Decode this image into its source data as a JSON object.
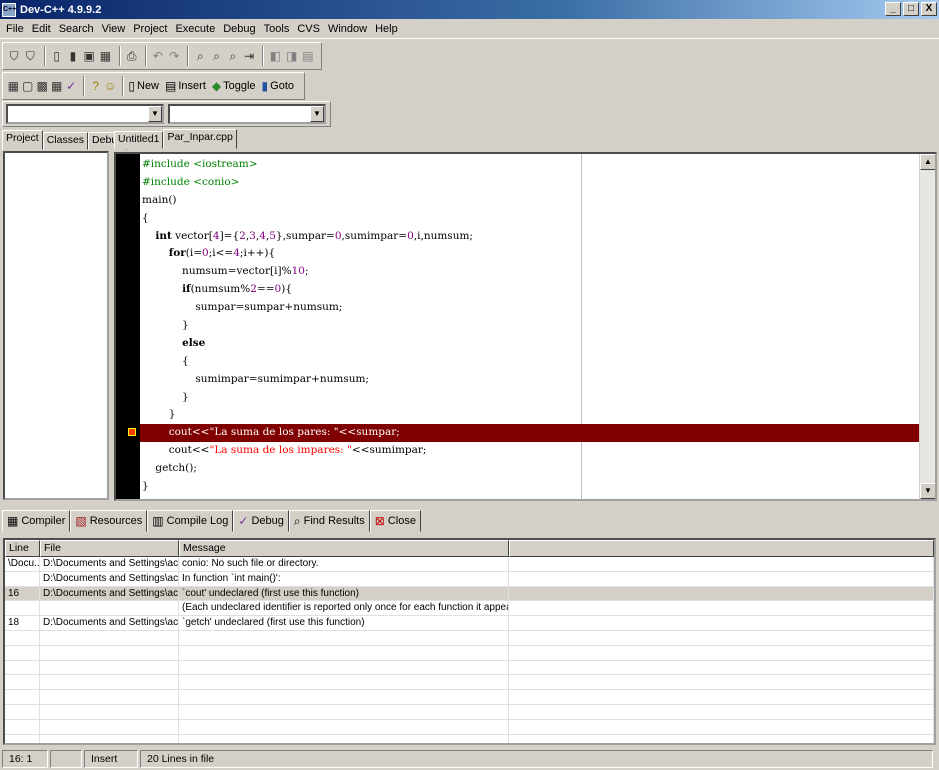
{
  "window": {
    "title": "Dev-C++ 4.9.9.2",
    "app_icon": "dev-cpp-icon",
    "controls": [
      "_",
      "□",
      "X"
    ]
  },
  "menu": [
    "File",
    "Edit",
    "Search",
    "View",
    "Project",
    "Execute",
    "Debug",
    "Tools",
    "CVS",
    "Window",
    "Help"
  ],
  "toolbar2": {
    "new_label": "New",
    "insert_label": "Insert",
    "toggle_label": "Toggle",
    "goto_label": "Goto"
  },
  "left_tabs": [
    "Project",
    "Classes",
    "Debug"
  ],
  "editor_tabs": [
    "Untitled1",
    "Par_Inpar.cpp"
  ],
  "active_editor_tab": 1,
  "error_line_index": 15,
  "code_lines": [
    "#include <iostream>",
    "#include <conio>",
    "main()",
    "{",
    "    int vector[4]={2,3,4,5},sumpar=0,sumimpar=0,i,numsum;",
    "        for(i=0;i<=4;i++){",
    "            numsum=vector[i]%10;",
    "            if(numsum%2==0){",
    "                sumpar=sumpar+numsum;",
    "            }",
    "            else",
    "            {",
    "                sumimpar=sumimpar+numsum;",
    "            }",
    "        }",
    "        cout<<\"La suma de los pares: \"<<sumpar;",
    "        cout<<\"La suma de los impares: \"<<sumimpar;",
    "    getch();",
    "}"
  ],
  "bottom_tabs": [
    {
      "label": "Compiler",
      "icon": "compiler-icon"
    },
    {
      "label": "Resources",
      "icon": "resources-icon"
    },
    {
      "label": "Compile Log",
      "icon": "compile-log-icon"
    },
    {
      "label": "Debug",
      "icon": "debug-check-icon"
    },
    {
      "label": "Find Results",
      "icon": "find-results-icon"
    },
    {
      "label": "Close",
      "icon": "close-icon"
    }
  ],
  "results": {
    "headers": [
      "Line",
      "File",
      "Message"
    ],
    "rows": [
      {
        "line": "\\Docu...",
        "file": "D:\\Documents and Settings\\acorrea\\...",
        "message": "conio: No such file or directory."
      },
      {
        "line": "",
        "file": "D:\\Documents and Settings\\acorrea\\...",
        "message": "In function `int main()':"
      },
      {
        "line": "16",
        "file": "D:\\Documents and Settings\\acorrea\\...",
        "message": "`cout' undeclared (first use this function)",
        "selected": true
      },
      {
        "line": "",
        "file": "",
        "message": "(Each undeclared identifier is reported only once for each function it appears in.)"
      },
      {
        "line": "18",
        "file": "D:\\Documents and Settings\\acorrea\\...",
        "message": "`getch' undeclared (first use this function)"
      }
    ],
    "empty_rows": 8
  },
  "status": {
    "position": "16: 1",
    "blank": "",
    "mode": "Insert",
    "info": "20 Lines in file"
  },
  "colors": {
    "title_start": "#0a246a",
    "error_line": "#800000",
    "preprocessor": "#008000",
    "string": "#ff0000",
    "number": "#800080"
  }
}
